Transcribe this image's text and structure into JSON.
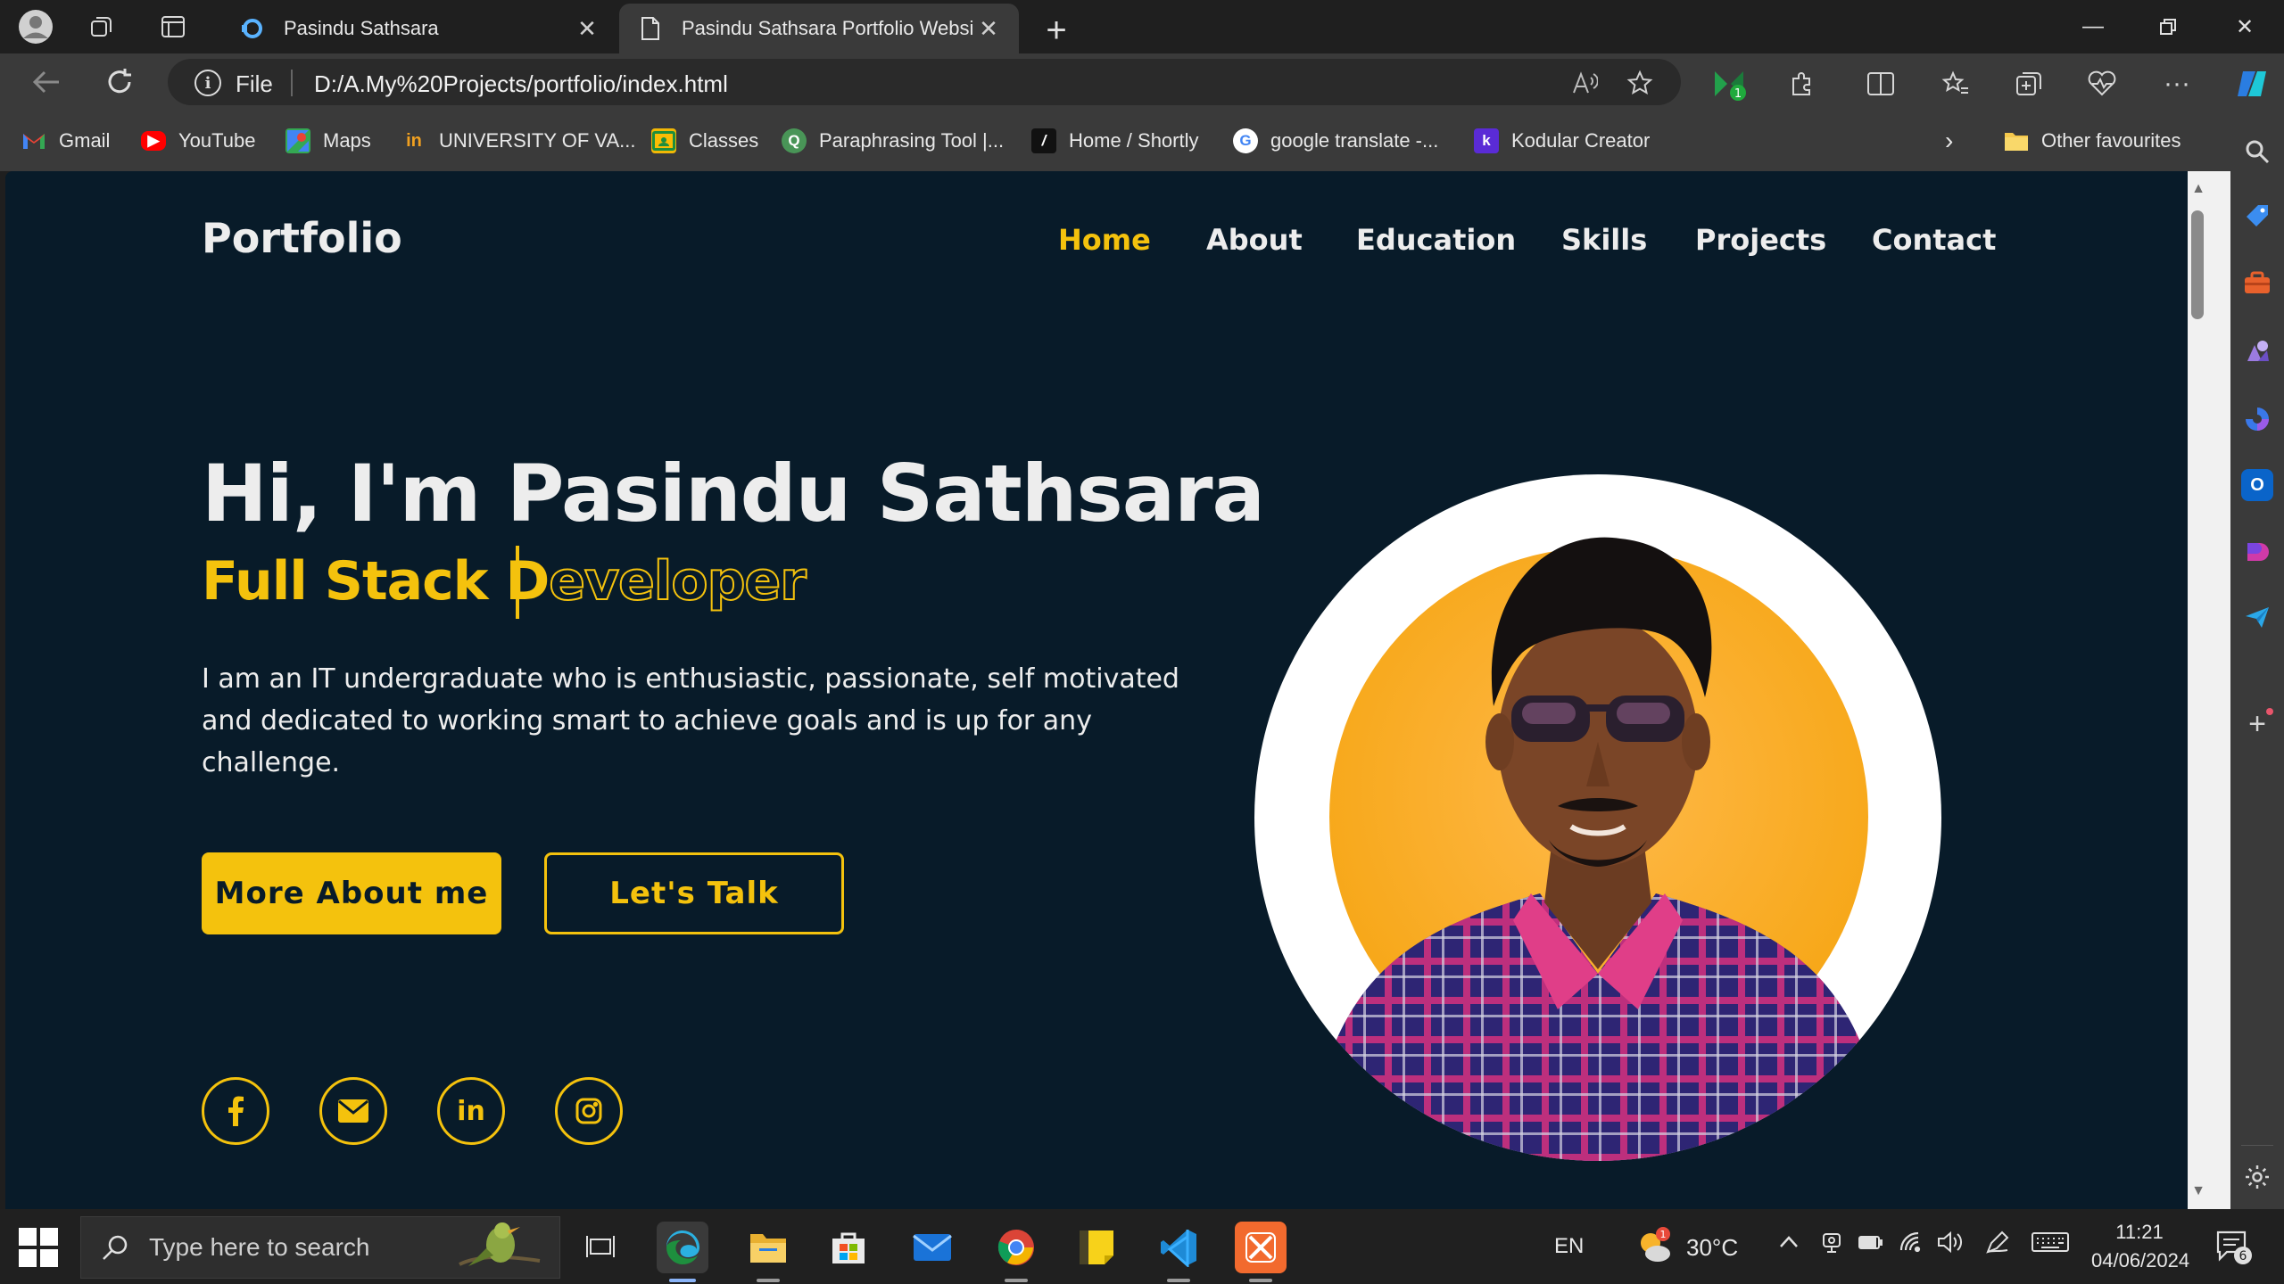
{
  "browser": {
    "tabs": [
      {
        "title": "Pasindu Sathsara",
        "active": false
      },
      {
        "title": "Pasindu Sathsara Portfolio Websi",
        "active": true
      }
    ],
    "address": {
      "scheme_label": "File",
      "url": "D:/A.My%20Projects/portfolio/index.html"
    },
    "bookmarks": [
      {
        "label": "Gmail",
        "icon": "gmail-icon"
      },
      {
        "label": "YouTube",
        "icon": "youtube-icon"
      },
      {
        "label": "Maps",
        "icon": "maps-icon"
      },
      {
        "label": "UNIVERSITY OF VA...",
        "icon": "university-icon"
      },
      {
        "label": "Classes",
        "icon": "classes-icon"
      },
      {
        "label": "Paraphrasing Tool |...",
        "icon": "quillbot-icon"
      },
      {
        "label": "Home / Shortly",
        "icon": "shortly-icon"
      },
      {
        "label": "google translate -...",
        "icon": "google-icon"
      },
      {
        "label": "Kodular Creator",
        "icon": "kodular-icon"
      }
    ],
    "other_favourites": "Other favourites",
    "extension_badge": "1"
  },
  "page": {
    "logo": "Portfolio",
    "nav": [
      "Home",
      "About",
      "Education",
      "Skills",
      "Projects",
      "Contact"
    ],
    "active_nav": "Home",
    "hero": {
      "title": "Hi, I'm Pasindu Sathsara",
      "subtitle_typed": "Full Stack D",
      "subtitle_rest": "eveloper",
      "description": "I am an IT undergraduate who is enthusiastic, passionate, self motivated and dedicated to working smart to achieve goals and is up for any challenge.",
      "primary_button": "More About me",
      "secondary_button": "Let's Talk"
    },
    "socials": [
      "facebook-icon",
      "mail-icon",
      "linkedin-icon",
      "instagram-icon"
    ],
    "colors": {
      "background": "#081b29",
      "accent": "#f4c20d",
      "text": "#ededed"
    }
  },
  "taskbar": {
    "search_placeholder": "Type here to search",
    "language": "EN",
    "temperature": "30°C",
    "weather_badge": "1",
    "time": "11:21",
    "date": "04/06/2024",
    "notification_count": "6"
  }
}
